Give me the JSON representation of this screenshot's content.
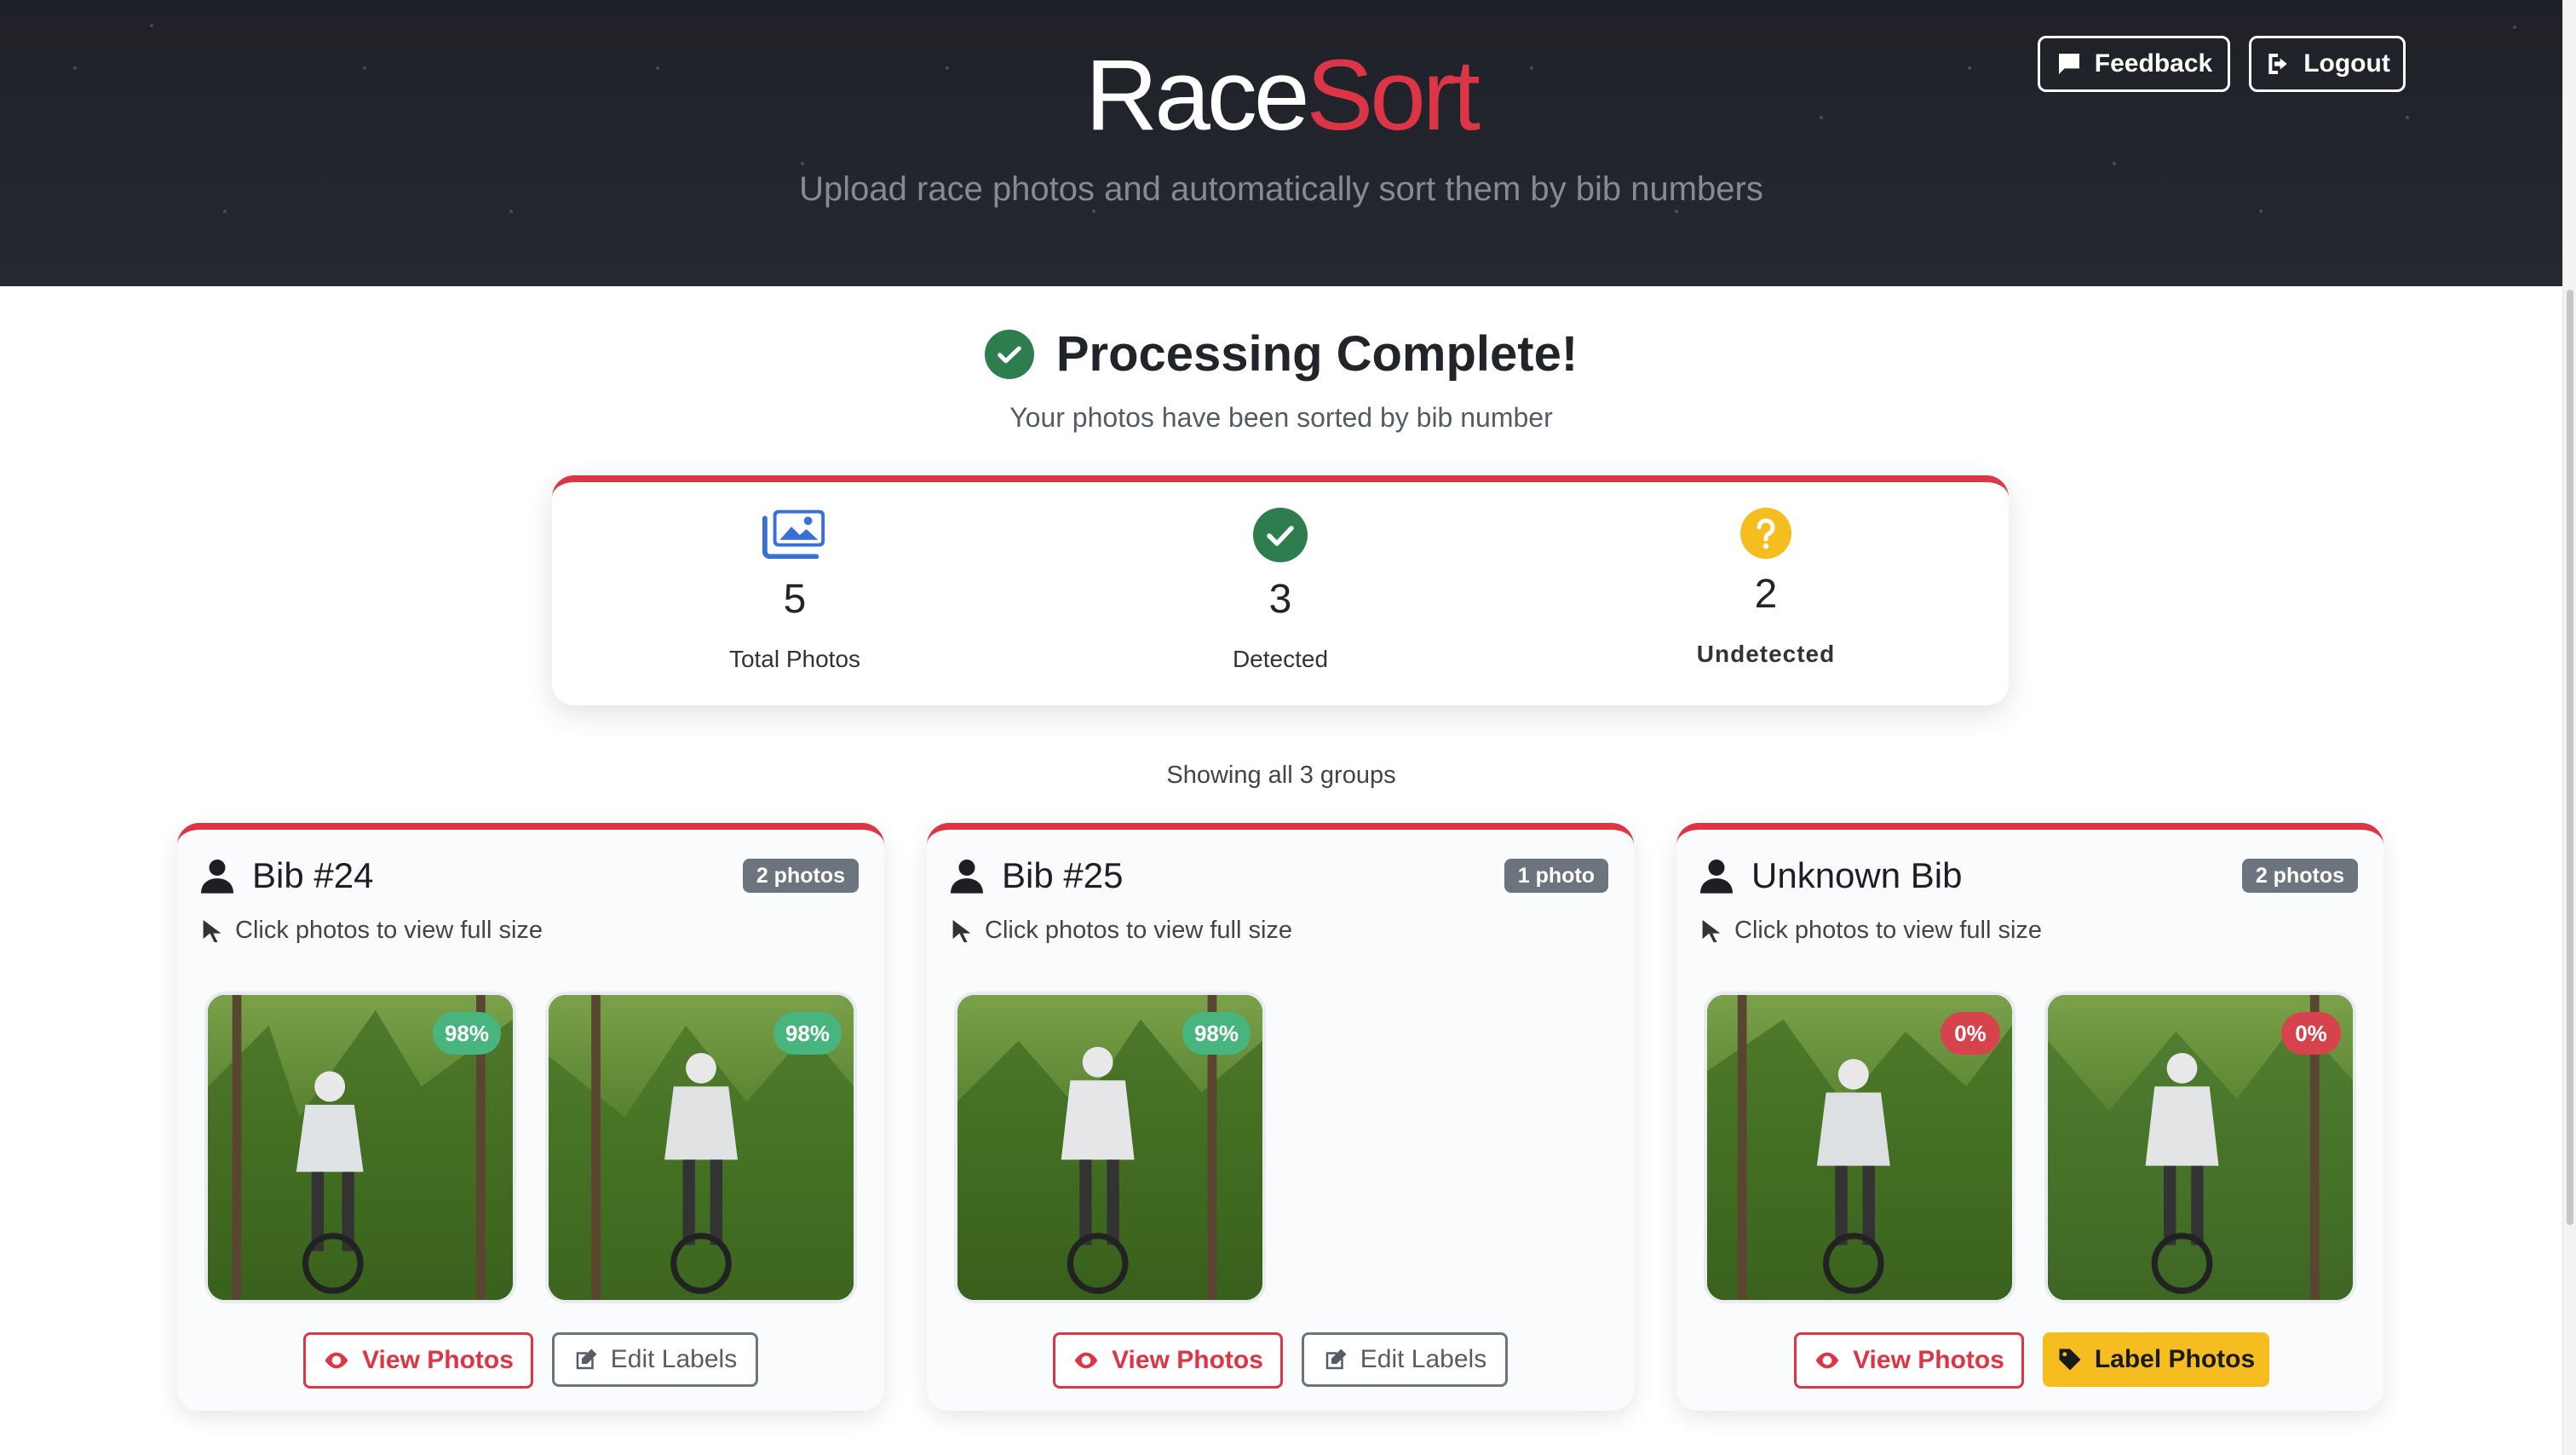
{
  "header": {
    "brand_part1": "Race",
    "brand_part2": "Sort",
    "tagline": "Upload race photos and automatically sort them by bib numbers",
    "feedback_label": "Feedback",
    "logout_label": "Logout"
  },
  "status": {
    "title": "Processing Complete!",
    "subtitle": "Your photos have been sorted by bib number"
  },
  "stats": [
    {
      "value": "5",
      "label": "Total Photos",
      "icon": "images-icon"
    },
    {
      "value": "3",
      "label": "Detected",
      "icon": "check-circle-icon"
    },
    {
      "value": "2",
      "label": "Undetected",
      "icon": "question-circle-icon"
    }
  ],
  "showing_text": "Showing all 3 groups",
  "groups": [
    {
      "title": "Bib #24",
      "count_label": "2 photos",
      "hint": "Click photos to view full size",
      "photos": [
        {
          "confidence": "98%"
        },
        {
          "confidence": "98%"
        }
      ],
      "view_label": "View Photos",
      "edit_label": "Edit Labels"
    },
    {
      "title": "Bib #25",
      "count_label": "1 photo",
      "hint": "Click photos to view full size",
      "photos": [
        {
          "confidence": "98%"
        }
      ],
      "view_label": "View Photos",
      "edit_label": "Edit Labels"
    },
    {
      "title": "Unknown Bib",
      "count_label": "2 photos",
      "hint": "Click photos to view full size",
      "photos": [
        {
          "confidence": "0%"
        },
        {
          "confidence": "0%"
        }
      ],
      "view_label": "View Photos",
      "label_label": "Label Photos"
    }
  ],
  "colors": {
    "accent": "#dc3545",
    "header_bg": "#1f2127",
    "success": "#2e7d4f",
    "warning": "#f5bd1f",
    "confidence_high": "#48b57e",
    "confidence_low": "#d6434d"
  }
}
